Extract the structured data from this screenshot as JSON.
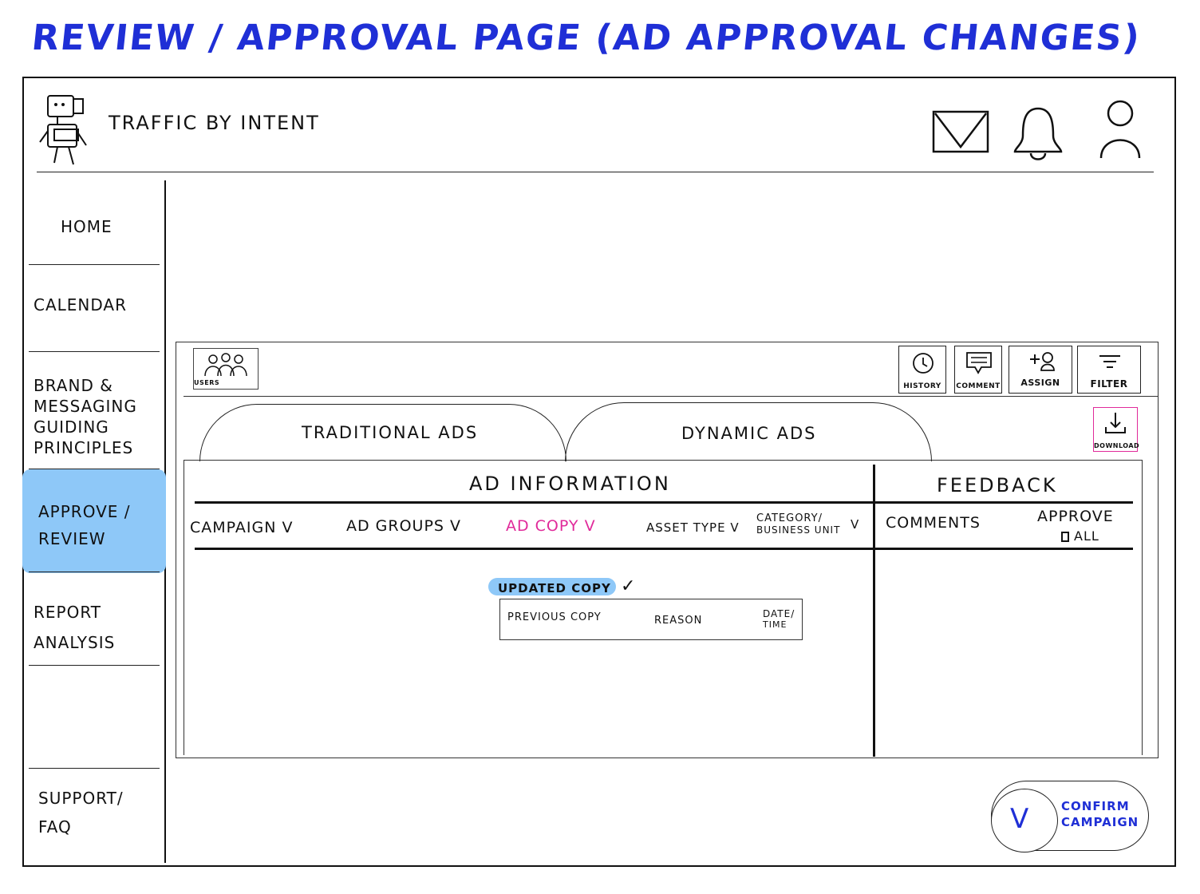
{
  "page_title": "REVIEW / APPROVAL PAGE (AD APPROVAL CHANGES)",
  "header": {
    "brand_name": "TRAFFIC BY INTENT",
    "icons": [
      "mail-icon",
      "bell-icon",
      "user-icon"
    ]
  },
  "sidebar": {
    "items": [
      {
        "label": "HOME"
      },
      {
        "label": "CALENDAR"
      },
      {
        "label": "BRAND & MESSAGING GUIDING PRINCIPLES"
      },
      {
        "label": "APPROVE / REVIEW"
      },
      {
        "label": "REPORT ANALYSIS"
      },
      {
        "label": "SUPPORT/ FAQ"
      }
    ],
    "active": "APPROVE / REVIEW",
    "active_color": "#8ec8f8"
  },
  "toolbar": {
    "users_label": "USERS",
    "history_label": "HISTORY",
    "comment_label": "COMMENT",
    "assign_label": "ASSIGN",
    "filter_label": "FILTER"
  },
  "tabs": {
    "traditional": "TRADITIONAL ADS",
    "dynamic": "DYNAMIC ADS"
  },
  "download_label": "DOWNLOAD",
  "table": {
    "ad_information_heading": "AD INFORMATION",
    "feedback_heading": "FEEDBACK",
    "columns": {
      "campaign": "CAMPAIGN V",
      "ad_groups": "AD GROUPS V",
      "ad_copy": "AD COPY V",
      "asset_type": "ASSET TYPE V",
      "category_line1": "CATEGORY/",
      "category_line2": "BUSINESS UNIT",
      "category_chevron": "V",
      "comments": "COMMENTS",
      "approve": "APPROVE",
      "approve_all": "ALL"
    },
    "highlight_color": "#e02a9a",
    "updated_copy_label": "UPDATED COPY",
    "updated_copy_check": "✓",
    "previous_copy_headers": {
      "previous_copy": "PREVIOUS COPY",
      "reason": "REASON",
      "date_time_line1": "DATE/",
      "date_time_line2": "TIME"
    }
  },
  "confirm": {
    "check": "V",
    "label_line1": "CONFIRM",
    "label_line2": "CAMPAIGN",
    "color": "#1f2fd6"
  }
}
